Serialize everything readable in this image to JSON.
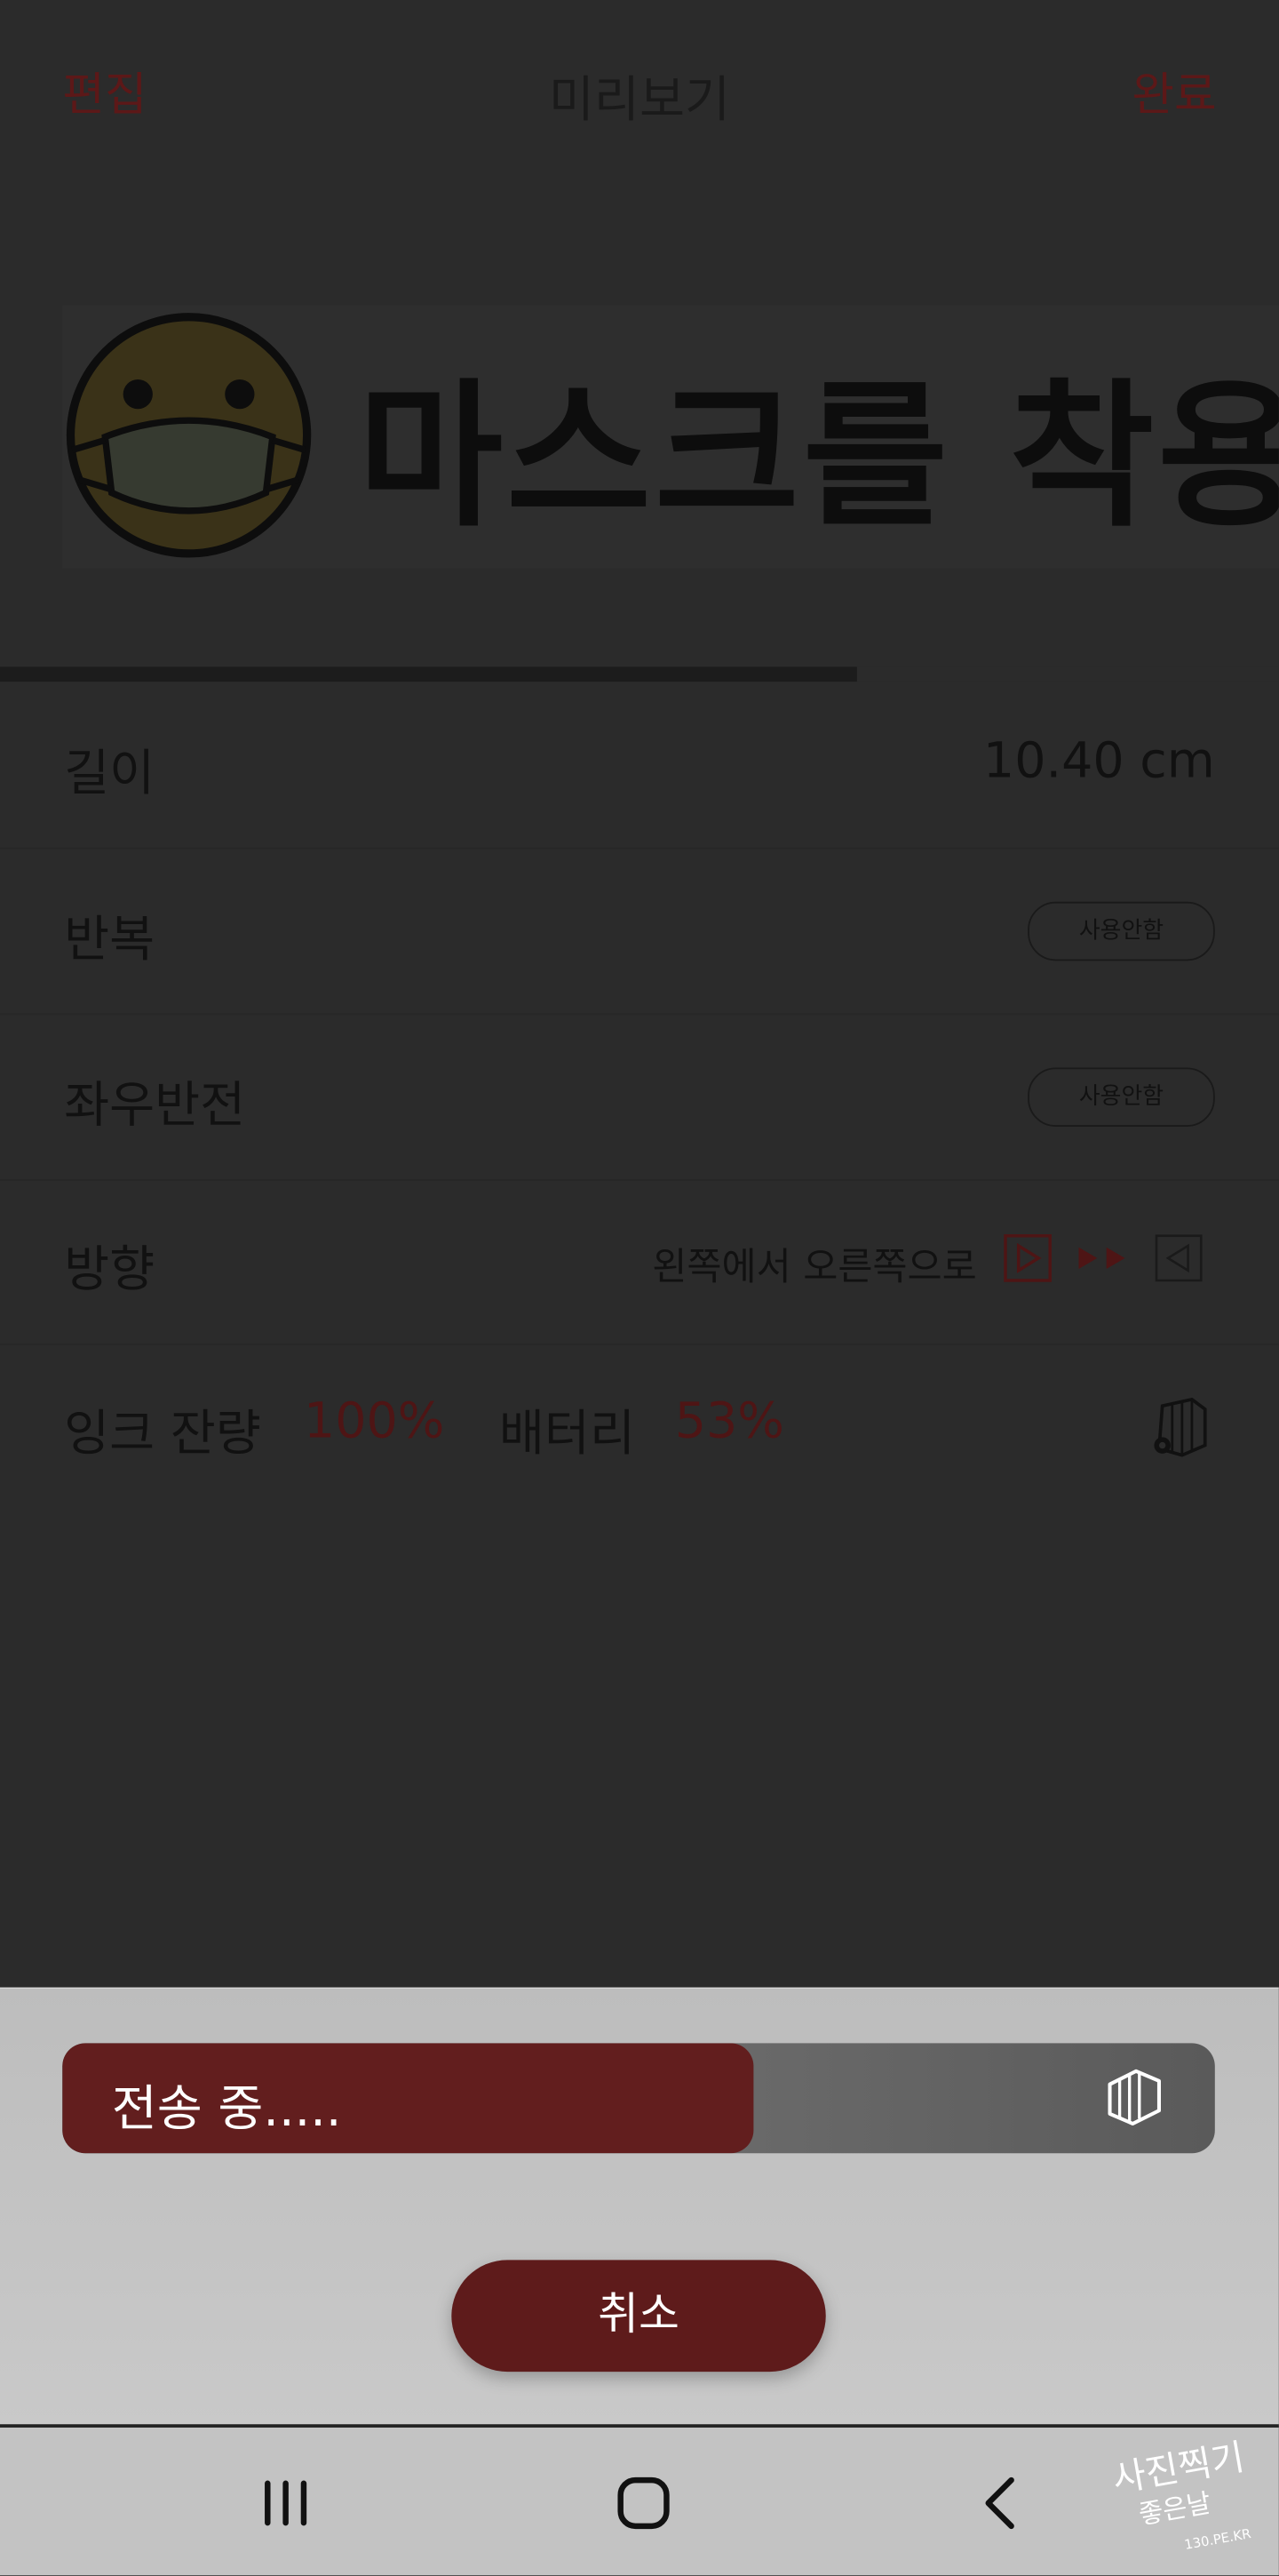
{
  "header": {
    "edit_label": "편집",
    "title": "미리보기",
    "done_label": "완료"
  },
  "preview": {
    "text": "마스크를 착용하",
    "progress_fraction": 0.67
  },
  "settings": {
    "length": {
      "label": "길이",
      "value": "10.40 cm"
    },
    "repeat": {
      "label": "반복",
      "value": "사용안함"
    },
    "mirror": {
      "label": "좌우반전",
      "value": "사용안함"
    },
    "direction": {
      "label": "방향",
      "value": "왼쪽에서 오른쪽으로"
    }
  },
  "status": {
    "ink_label": "잉크 잔량",
    "ink_value": "100%",
    "battery_label": "배터리",
    "battery_value": "53%"
  },
  "transfer": {
    "label": "전송 중.....",
    "progress_fraction": 0.6,
    "cancel_label": "취소"
  },
  "watermark": {
    "line1": "사진찍기",
    "line2": "좋은날",
    "site": "130.PE.KR"
  },
  "colors": {
    "accent": "#621e1e",
    "overlay_bg": "#2b2b2b",
    "sheet_bg": "#c4c4c4"
  },
  "icons": [
    "emoji-mask-icon",
    "play-right-icon",
    "double-arrow-icon",
    "play-left-icon",
    "printer-settings-icon",
    "device-icon",
    "recent-apps-icon",
    "home-icon",
    "back-icon"
  ]
}
